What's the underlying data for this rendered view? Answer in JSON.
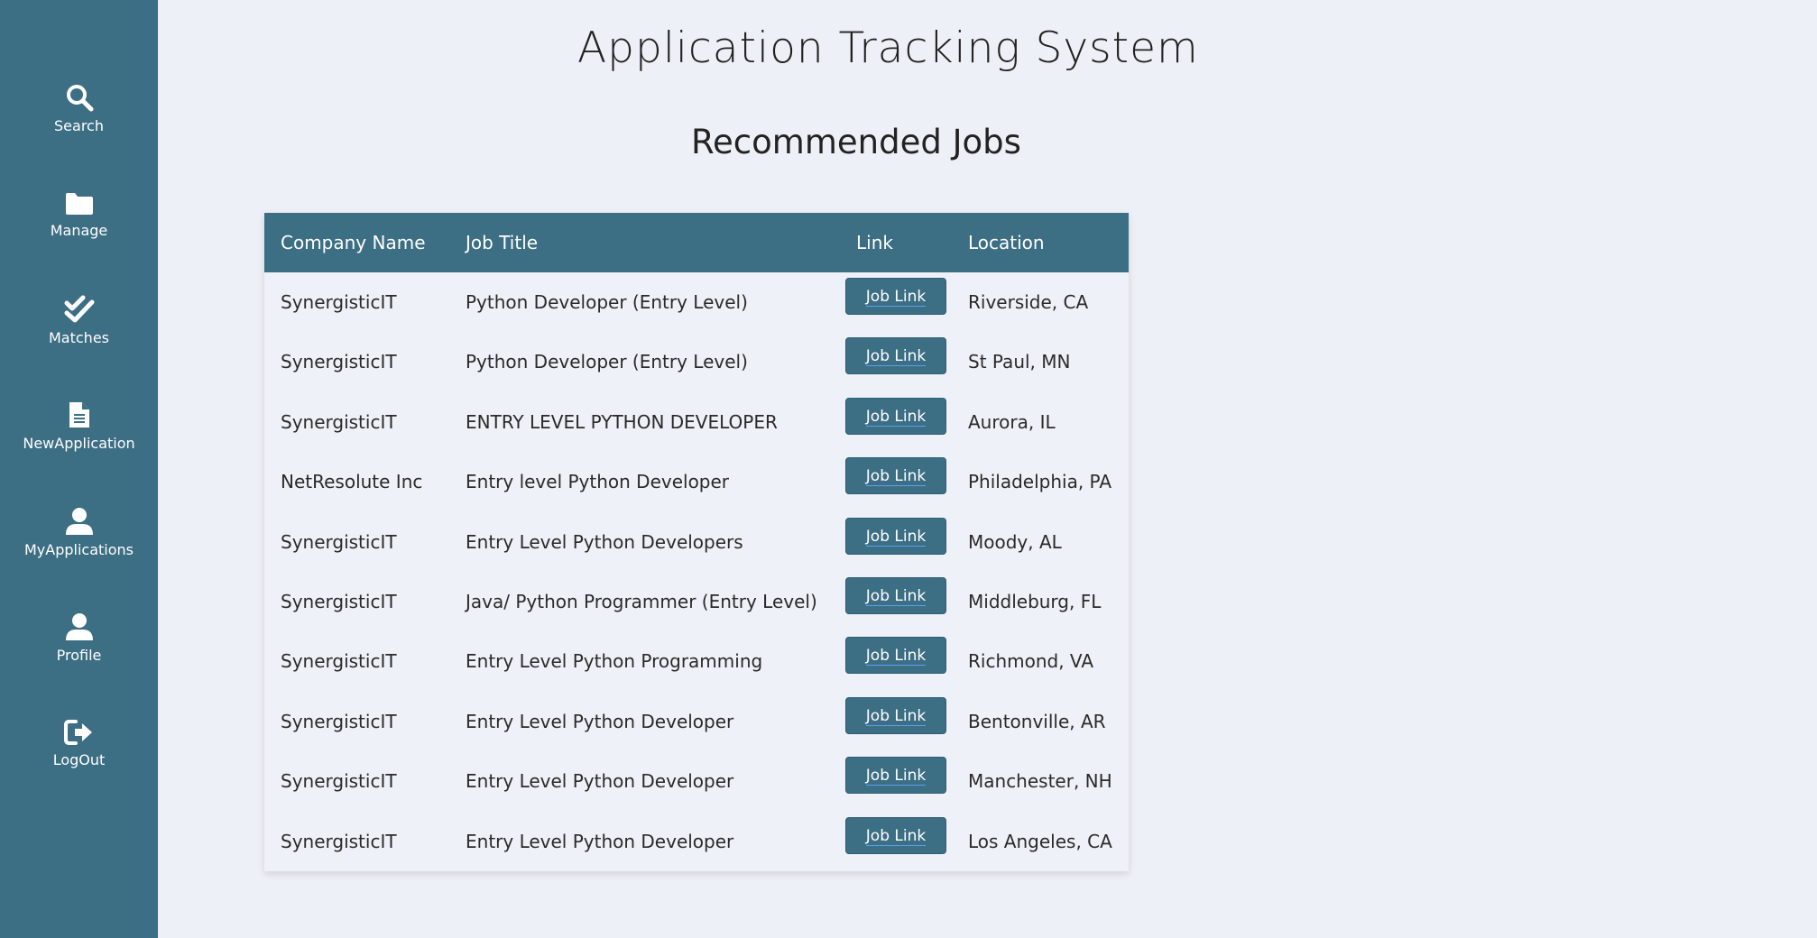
{
  "app": {
    "title": "Application Tracking System"
  },
  "sidebar": {
    "items": [
      {
        "label": "Search",
        "icon": "search-icon"
      },
      {
        "label": "Manage",
        "icon": "folder-icon"
      },
      {
        "label": "Matches",
        "icon": "double-check-icon"
      },
      {
        "label": "NewApplication",
        "icon": "document-icon"
      },
      {
        "label": "MyApplications",
        "icon": "user-icon"
      },
      {
        "label": "Profile",
        "icon": "user-icon"
      },
      {
        "label": "LogOut",
        "icon": "logout-icon"
      }
    ]
  },
  "main": {
    "section_title": "Recommended Jobs",
    "table": {
      "headers": [
        "Company Name",
        "Job Title",
        "Link",
        "Location"
      ],
      "rows": [
        {
          "company": "SynergisticIT",
          "title": "Python Developer (Entry Level)",
          "link": "Job Link",
          "location": "Riverside, CA"
        },
        {
          "company": "SynergisticIT",
          "title": "Python Developer (Entry Level)",
          "link": "Job Link",
          "location": "St Paul, MN"
        },
        {
          "company": "SynergisticIT",
          "title": "ENTRY LEVEL PYTHON DEVELOPER",
          "link": "Job Link",
          "location": "Aurora, IL"
        },
        {
          "company": "NetResolute Inc",
          "title": "Entry level Python Developer",
          "link": "Job Link",
          "location": "Philadelphia, PA"
        },
        {
          "company": "SynergisticIT",
          "title": "Entry Level Python Developers",
          "link": "Job Link",
          "location": "Moody, AL"
        },
        {
          "company": "SynergisticIT",
          "title": "Java/ Python Programmer (Entry Level)",
          "link": "Job Link",
          "location": "Middleburg, FL"
        },
        {
          "company": "SynergisticIT",
          "title": "Entry Level Python Programming",
          "link": "Job Link",
          "location": "Richmond, VA"
        },
        {
          "company": "SynergisticIT",
          "title": "Entry Level Python Developer",
          "link": "Job Link",
          "location": "Bentonville, AR"
        },
        {
          "company": "SynergisticIT",
          "title": "Entry Level Python Developer",
          "link": "Job Link",
          "location": "Manchester, NH"
        },
        {
          "company": "SynergisticIT",
          "title": "Entry Level Python Developer",
          "link": "Job Link",
          "location": "Los Angeles, CA"
        }
      ]
    }
  },
  "colors": {
    "sidebar_bg": "#3c6e84",
    "page_bg": "#edf0f6",
    "header_bg": "#3c6e84",
    "button_bg": "#3c6e84"
  }
}
